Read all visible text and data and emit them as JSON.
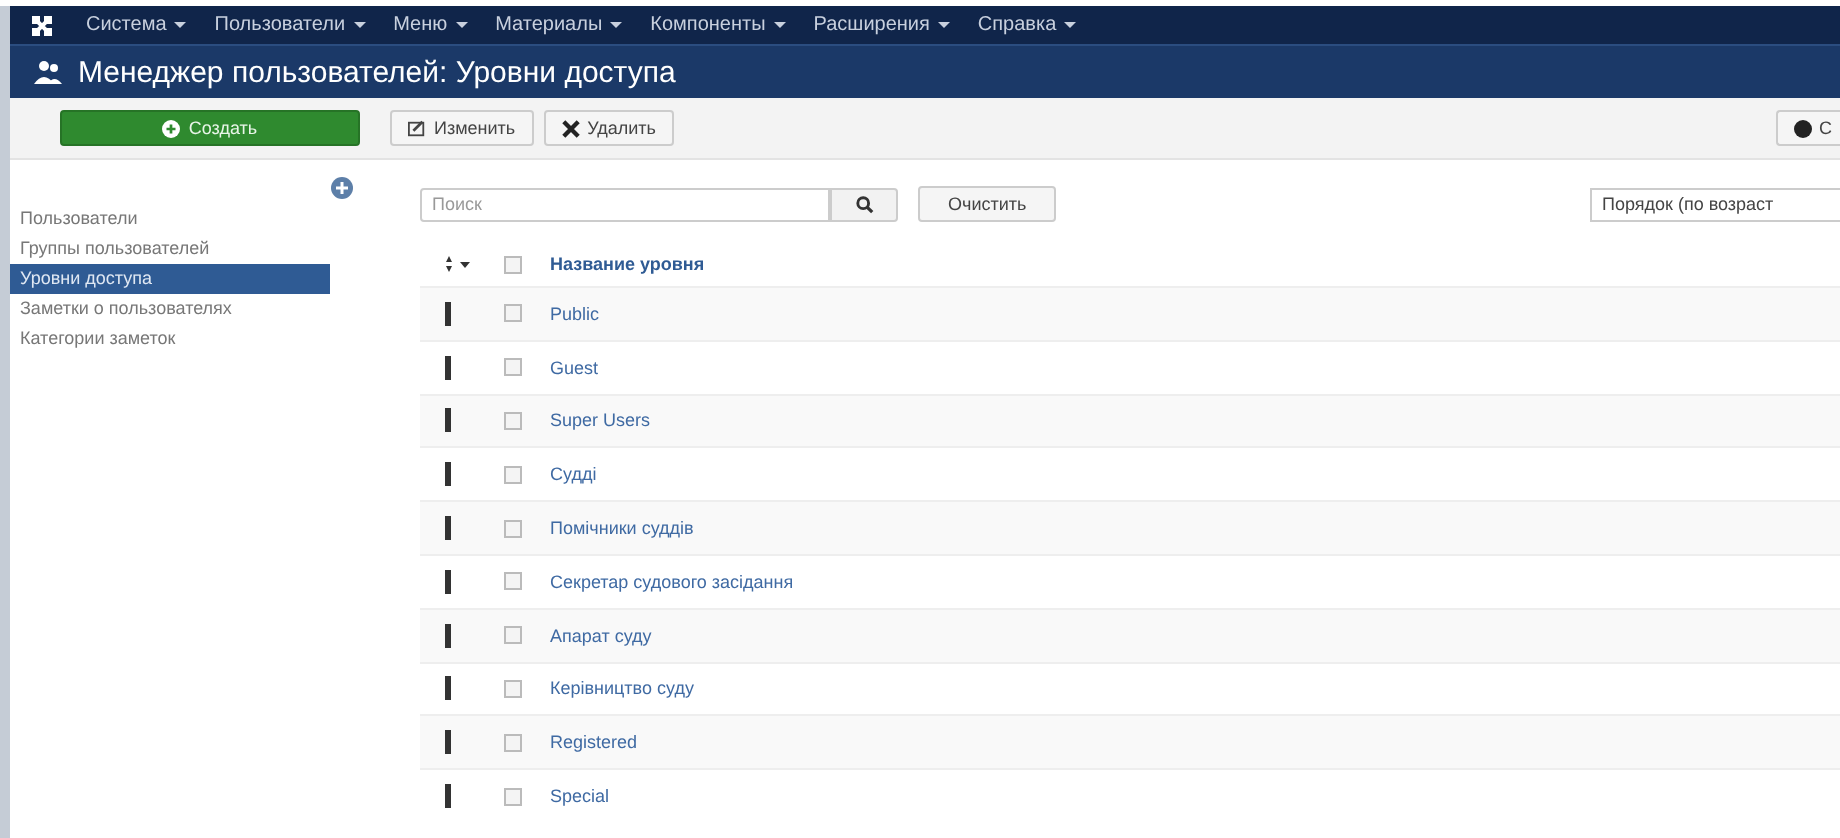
{
  "menu": [
    {
      "label": "Система"
    },
    {
      "label": "Пользователи"
    },
    {
      "label": "Меню"
    },
    {
      "label": "Материалы"
    },
    {
      "label": "Компоненты"
    },
    {
      "label": "Расширения"
    },
    {
      "label": "Справка"
    }
  ],
  "title": "Менеджер пользователей: Уровни доступа",
  "toolbar": [
    {
      "label": "Создать",
      "kind": "primary"
    },
    {
      "label": "Изменить",
      "kind": "edit"
    },
    {
      "label": "Удалить",
      "kind": "delete"
    }
  ],
  "toolbar_right": {
    "label": "С"
  },
  "sidebar": {
    "items": [
      {
        "label": "Пользователи",
        "selected": false
      },
      {
        "label": "Группы пользователей",
        "selected": false
      },
      {
        "label": "Уровни доступа",
        "selected": true
      },
      {
        "label": "Заметки о пользователях",
        "selected": false
      },
      {
        "label": "Категории заметок",
        "selected": false
      }
    ]
  },
  "search": {
    "placeholder": "Поиск"
  },
  "clear_button": "Очистить",
  "ordering": "Порядок (по возраст",
  "table": {
    "column": "Название уровня",
    "all_checked": false,
    "rows": [
      {
        "name": "Public",
        "checked": false
      },
      {
        "name": "Guest",
        "checked": false
      },
      {
        "name": "Super Users",
        "checked": false
      },
      {
        "name": "Судді",
        "checked": false
      },
      {
        "name": "Помічники суддів",
        "checked": false
      },
      {
        "name": "Секретар судового засідання",
        "checked": false
      },
      {
        "name": "Апарат суду",
        "checked": false
      },
      {
        "name": "Керівництво суду",
        "checked": false
      },
      {
        "name": "Registered",
        "checked": false
      },
      {
        "name": "Special",
        "checked": false
      }
    ]
  }
}
